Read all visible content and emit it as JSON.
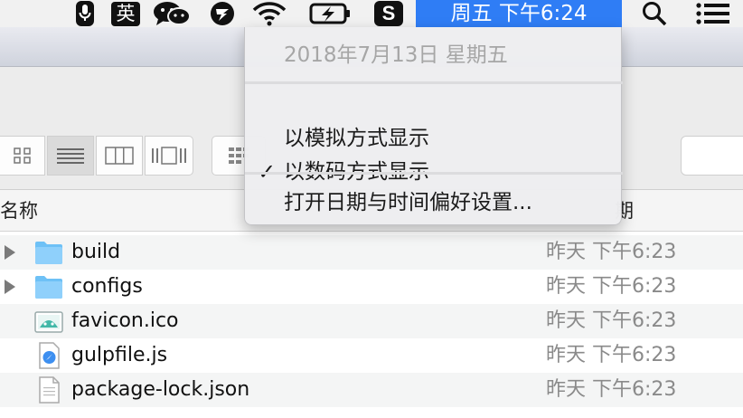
{
  "menubar": {
    "ime_label": "英",
    "sogou_label": "S",
    "clock": "周五 下午6:24",
    "icons": [
      "microphone-icon",
      "input-method-icon",
      "wechat-icon",
      "lark-icon",
      "wifi-icon",
      "battery-charging-icon",
      "sogou-icon",
      "spotlight-search-icon",
      "notification-center-icon"
    ]
  },
  "clock_menu": {
    "date": "2018年7月13日 星期五",
    "items": [
      {
        "label": "以模拟方式显示",
        "checked": false
      },
      {
        "label": "以数码方式显示",
        "checked": true
      }
    ],
    "check_mark": "✓",
    "prefs": "打开日期与时间偏好设置..."
  },
  "finder": {
    "view_buttons": [
      "icon-view-icon",
      "list-view-icon",
      "column-view-icon",
      "gallery-view-icon",
      "group-icon"
    ],
    "columns": {
      "name": "名称",
      "date": "期"
    },
    "files": [
      {
        "name": "build",
        "date": "昨天 下午6:23",
        "kind": "folder",
        "expandable": true
      },
      {
        "name": "configs",
        "date": "昨天 下午6:23",
        "kind": "folder",
        "expandable": true
      },
      {
        "name": "favicon.ico",
        "date": "昨天 下午6:23",
        "kind": "image",
        "expandable": false
      },
      {
        "name": "gulpfile.js",
        "date": "昨天 下午6:23",
        "kind": "js",
        "expandable": false
      },
      {
        "name": "package-lock.json",
        "date": "昨天 下午6:23",
        "kind": "doc",
        "expandable": false
      }
    ]
  },
  "colors": {
    "accent": "#2f7df5",
    "folder": "#6ec1f6",
    "menubar_bg": "#f1f1f1"
  }
}
